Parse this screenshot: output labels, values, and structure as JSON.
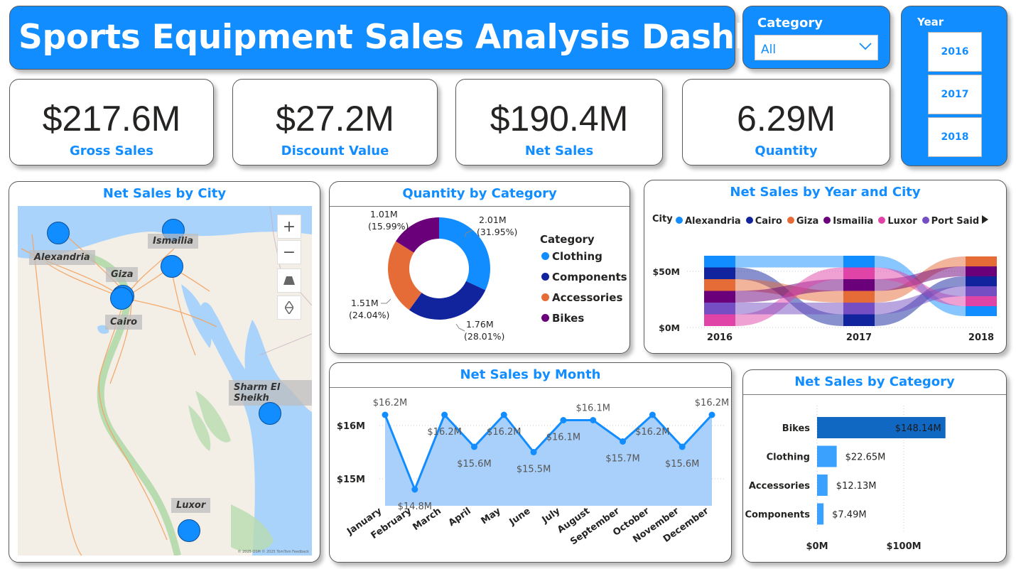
{
  "header": {
    "title": "Sports Equipment Sales Analysis Dashboard"
  },
  "category_filter": {
    "title": "Category",
    "selected": "All"
  },
  "year_filter": {
    "title": "Year",
    "options": [
      "2016",
      "2017",
      "2018"
    ]
  },
  "kpis": [
    {
      "value": "$217.6M",
      "label": "Gross Sales"
    },
    {
      "value": "$27.2M",
      "label": "Discount Value"
    },
    {
      "value": "$190.4M",
      "label": "Net Sales"
    },
    {
      "value": "6.29M",
      "label": "Quantity"
    }
  ],
  "map": {
    "title": "Net Sales by City",
    "cities": [
      "Alexandria",
      "Ismailia",
      "Giza",
      "Cairo",
      "Sharm El Sheikh",
      "Luxor"
    ],
    "attribution": "© 2025 OSM © 2025 TomTom Feedback"
  },
  "colors": {
    "accent": "#118DFF",
    "navy": "#12239E",
    "orange": "#E66C37",
    "purple": "#6B007B",
    "pink": "#E044A7",
    "dark_purple": "#744EC2",
    "green": "#2DB55D"
  },
  "donut": {
    "title": "Quantity by Category",
    "legend_title": "Category",
    "chart_data": {
      "type": "pie",
      "categories": [
        "Clothing",
        "Components",
        "Accessories",
        "Bikes"
      ],
      "values": [
        2.01,
        1.76,
        1.51,
        1.01
      ],
      "unit": "M",
      "labels": [
        "2.01M",
        "1.76M",
        "1.51M",
        "1.01M"
      ],
      "percent_labels": [
        "(31.95%)",
        "(28.01%)",
        "(24.04%)",
        "(15.99%)"
      ],
      "colors": [
        "#118DFF",
        "#12239E",
        "#E66C37",
        "#6B007B"
      ]
    }
  },
  "ribbon": {
    "title": "Net Sales by Year and City",
    "legend_title": "City",
    "chart_data": {
      "type": "area",
      "x": [
        "2016",
        "2017",
        "2018"
      ],
      "series": [
        {
          "name": "Alexandria",
          "color": "#118DFF"
        },
        {
          "name": "Cairo",
          "color": "#12239E"
        },
        {
          "name": "Giza",
          "color": "#E66C37"
        },
        {
          "name": "Ismailia",
          "color": "#6B007B"
        },
        {
          "name": "Luxor",
          "color": "#E044A7"
        },
        {
          "name": "Port Said",
          "color": "#744EC2"
        }
      ],
      "y_ticks": [
        "$0M",
        "$50M"
      ]
    }
  },
  "monthly": {
    "title": "Net Sales by Month",
    "chart_data": {
      "type": "area",
      "categories": [
        "January",
        "February",
        "March",
        "April",
        "May",
        "June",
        "July",
        "August",
        "September",
        "October",
        "November",
        "December"
      ],
      "values": [
        16.2,
        14.8,
        16.2,
        15.6,
        16.2,
        15.5,
        16.1,
        16.1,
        15.7,
        16.2,
        15.6,
        16.2
      ],
      "data_labels": [
        "$16.2M",
        "$14.8M",
        "$16.2M",
        "$15.6M",
        "$16.2M",
        "$15.5M",
        "$16.1M",
        "$16.1M",
        "$15.7M",
        "$16.2M",
        "$15.6M",
        "$16.2M"
      ],
      "y_ticks": [
        "$15M",
        "$16M"
      ],
      "ylim": [
        14.3,
        16.55
      ]
    }
  },
  "bycat": {
    "title": "Net Sales by Category",
    "chart_data": {
      "type": "bar",
      "categories": [
        "Bikes",
        "Clothing",
        "Accessories",
        "Components"
      ],
      "values": [
        148.14,
        22.65,
        12.13,
        7.49
      ],
      "data_labels": [
        "$148.14M",
        "$22.65M",
        "$12.13M",
        "$7.49M"
      ],
      "x_ticks": [
        "$0M",
        "$100M"
      ],
      "xlim": [
        0,
        200
      ]
    }
  }
}
